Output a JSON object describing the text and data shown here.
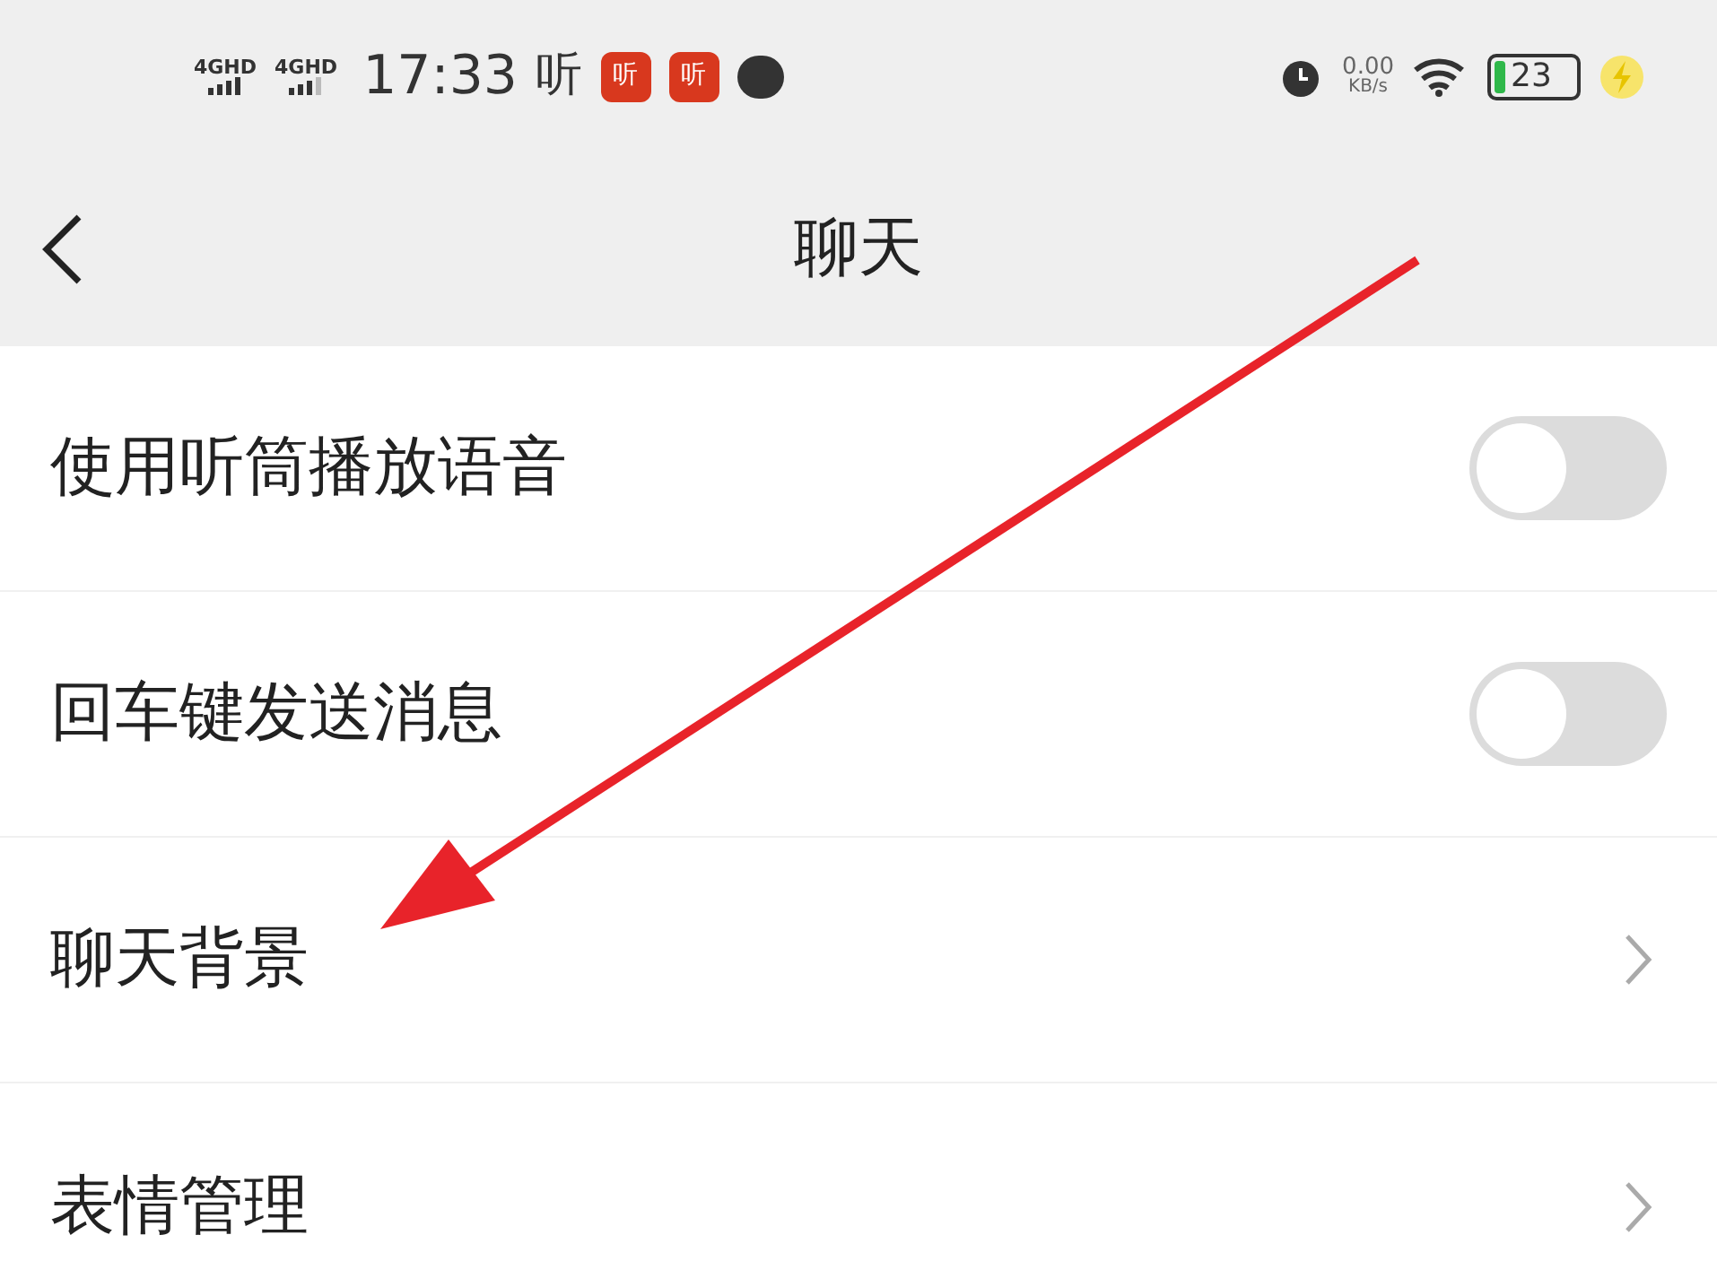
{
  "status_bar": {
    "signals": [
      "4GHD",
      "4GHD"
    ],
    "time": "17:33",
    "notifications": [
      {
        "label": "听",
        "kind": "plain"
      },
      {
        "label": "听",
        "kind": "badge"
      },
      {
        "label": "听",
        "kind": "badge"
      }
    ],
    "speed": "0.00",
    "speed_unit": "KB/s",
    "battery": "23",
    "charging": true
  },
  "header": {
    "title": "聊天"
  },
  "rows": [
    {
      "label": "使用听筒播放语音",
      "kind": "toggle",
      "on": false
    },
    {
      "label": "回车键发送消息",
      "kind": "toggle",
      "on": false
    },
    {
      "label": "聊天背景",
      "kind": "link"
    },
    {
      "label": "表情管理",
      "kind": "link"
    }
  ]
}
